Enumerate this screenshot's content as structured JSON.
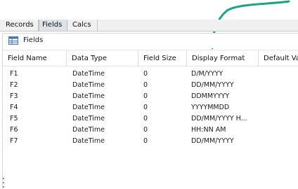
{
  "tabs": [
    {
      "label": "Records",
      "active": false
    },
    {
      "label": "Fields",
      "active": true
    },
    {
      "label": "Calcs",
      "active": false
    }
  ],
  "panel": {
    "title": "Fields",
    "icon": "table-icon"
  },
  "table": {
    "columns": [
      "Field Name",
      "Data Type",
      "Field Size",
      "Display Format",
      "Default Val"
    ],
    "rows": [
      {
        "name": "F1",
        "type": "DateTime",
        "size": "0",
        "format": "D/M/YYYY"
      },
      {
        "name": "F2",
        "type": "DateTime",
        "size": "0",
        "format": "DD/MM/YYYY"
      },
      {
        "name": "F3",
        "type": "DateTime",
        "size": "0",
        "format": "DDMMYYYY"
      },
      {
        "name": "F4",
        "type": "DateTime",
        "size": "0",
        "format": "YYYYMMDD"
      },
      {
        "name": "F5",
        "type": "DateTime",
        "size": "0",
        "format": "DD/MM/YYYY H..."
      },
      {
        "name": "F6",
        "type": "DateTime",
        "size": "0",
        "format": "HH:NN AM"
      },
      {
        "name": "F7",
        "type": "DateTime",
        "size": "0",
        "format": "DD/MM/YYYY"
      }
    ]
  },
  "annotation": {
    "type": "arrow",
    "color": "#1aa384",
    "points_to": "Display Format column"
  }
}
